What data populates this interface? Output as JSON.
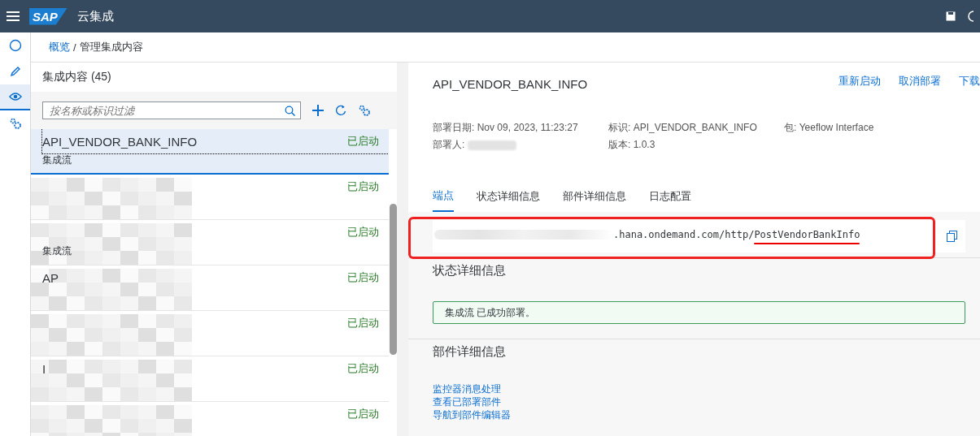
{
  "shell": {
    "logo": "SAP",
    "title": "云集成"
  },
  "nav": [
    {
      "selected": false
    },
    {
      "selected": false
    },
    {
      "selected": true
    },
    {
      "selected": false
    }
  ],
  "breadcrumb": {
    "link": "概览",
    "separator": "/",
    "current": "管理集成内容"
  },
  "list": {
    "title": "集成内容 (45)",
    "filter_placeholder": "按名称或标识过滤",
    "items": [
      {
        "name": "API_VENDOR_BANK_INFO",
        "subtitle": "集成流",
        "status": "已启动",
        "selected": true,
        "redacted": false
      },
      {
        "status": "已启动",
        "selected": false,
        "redacted": true
      },
      {
        "subtitle": "集成流",
        "status": "已启动",
        "selected": false,
        "redacted": true
      },
      {
        "name": "AP",
        "status": "已启动",
        "selected": false,
        "redacted": true
      },
      {
        "status": "已启动",
        "selected": false,
        "redacted": true
      },
      {
        "name": "I",
        "status": "已启动",
        "selected": false,
        "redacted": true
      },
      {
        "status": "已启动",
        "selected": false,
        "redacted": true
      }
    ]
  },
  "detail": {
    "title": "API_VENDOR_BANK_INFO",
    "actions": [
      "重新启动",
      "取消部署",
      "下载"
    ],
    "fields": [
      {
        "label": "部署日期:",
        "value": "Nov 09, 2023, 11:23:27"
      },
      {
        "label": "标识:",
        "value": "API_VENDOR_BANK_INFO"
      },
      {
        "label": "包:",
        "value": "Yeeflow Interface"
      },
      {
        "label": "部署人:",
        "redacted": true
      },
      {
        "label": "版本:",
        "value": "1.0.3"
      }
    ],
    "tabs": [
      {
        "label": "端点",
        "selected": true
      },
      {
        "label": "状态详细信息",
        "selected": false
      },
      {
        "label": "部件详细信息",
        "selected": false
      },
      {
        "label": "日志配置",
        "selected": false
      }
    ],
    "endpoint": {
      "url": ".hana.ondemand.com/http/",
      "url_end": "PostVendorBankInfo",
      "annotated": true
    },
    "status_section": {
      "title": "状态详细信息",
      "message": "集成流 已成功部署。"
    },
    "artifact_section": {
      "title": "部件详细信息",
      "links": [
        "监控器消息处理",
        "查看已部署部件",
        "导航到部件编辑器"
      ]
    }
  }
}
